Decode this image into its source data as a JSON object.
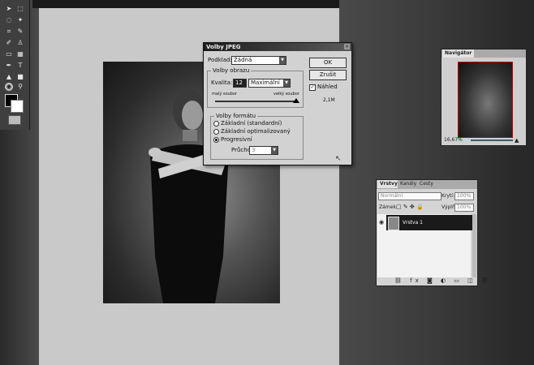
{
  "jpeg_dialog": {
    "title": "Volby JPEG",
    "matte_label": "Podklad:",
    "matte_value": "Žádná",
    "image_options_label": "Volby obrazu",
    "quality_label": "Kvalita:",
    "quality_value": "12",
    "quality_preset": "Maximální",
    "small_file": "malý soubor",
    "large_file": "velký soubor",
    "format_options_label": "Volby formátu",
    "format_options": [
      "Základní (standardní)",
      "Základní optimalizovaný",
      "Progresivní"
    ],
    "selected_format": 2,
    "scans_label": "Průchodů:",
    "scans_value": "3",
    "ok_label": "OK",
    "cancel_label": "Zrušit",
    "preview_label": "Náhled",
    "preview_checked": true,
    "file_size": "2,1M"
  },
  "navigator": {
    "tab": "Navigátor",
    "zoom": "16,67%"
  },
  "layers": {
    "tabs": [
      "Vrstvy",
      "Kanály",
      "Cesty"
    ],
    "blend_mode": "Normální",
    "opacity_label": "Krytí:",
    "opacity_value": "100%",
    "lock_label": "Zámek:",
    "fill_label": "Výplň:",
    "fill_value": "100%",
    "layer_name": "Vrstva 1"
  },
  "tools": {
    "text_tool_glyph": "T"
  }
}
